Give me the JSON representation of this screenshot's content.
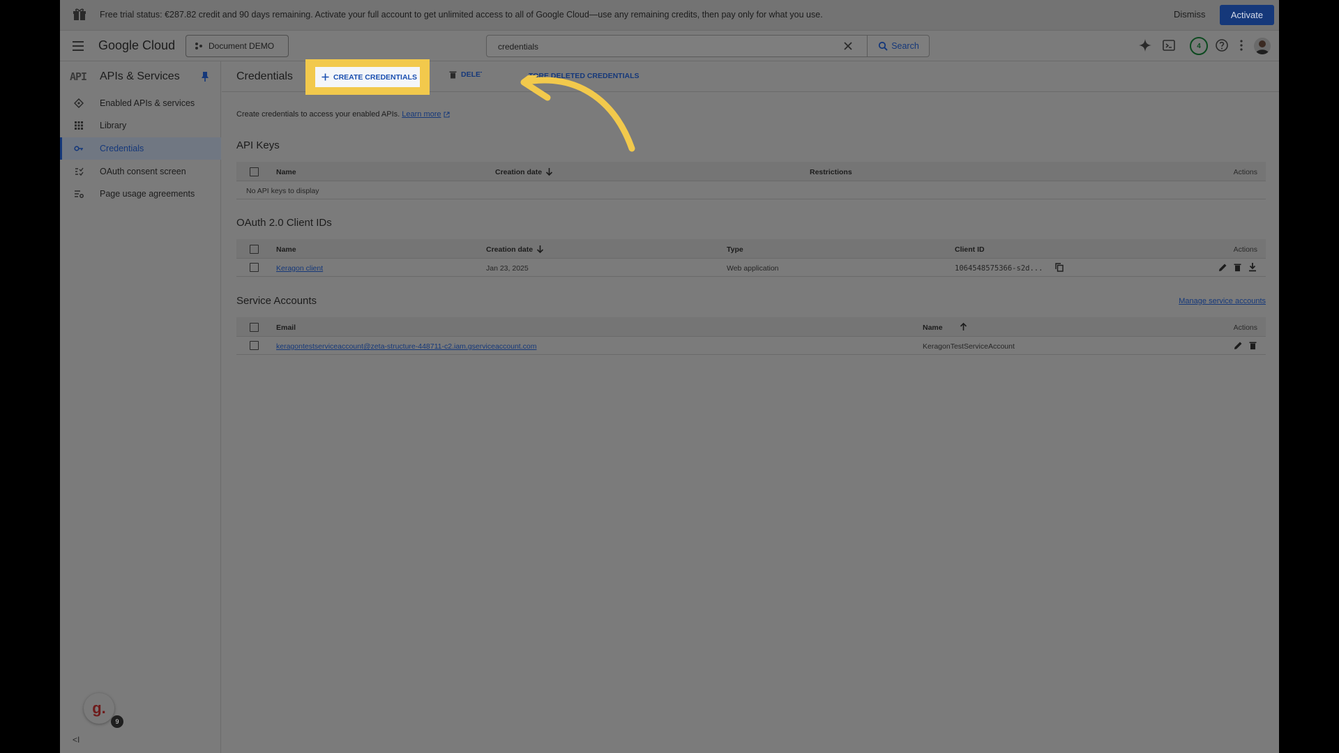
{
  "banner": {
    "text": "Free trial status: €287.82 credit and 90 days remaining. Activate your full account to get unlimited access to all of Google Cloud—use any remaining credits, then pay only for what you use.",
    "dismiss_label": "Dismiss",
    "activate_label": "Activate"
  },
  "header": {
    "logo_text": "Google Cloud",
    "project_label": "Document DEMO",
    "search_value": "credentials",
    "search_button_label": "Search",
    "notification_count": "4"
  },
  "sidebar": {
    "api_mark": "API",
    "title": "APIs & Services",
    "items": [
      {
        "label": "Enabled APIs & services",
        "icon": "diamond-icon"
      },
      {
        "label": "Library",
        "icon": "library-icon"
      },
      {
        "label": "Credentials",
        "icon": "key-icon",
        "active": true
      },
      {
        "label": "OAuth consent screen",
        "icon": "consent-icon"
      },
      {
        "label": "Page usage agreements",
        "icon": "settings-list-icon"
      }
    ],
    "assistant_letter": "g.",
    "assistant_count": "9",
    "collapse_label": "<I"
  },
  "main": {
    "page_title": "Credentials",
    "create_label": "CREATE CREDENTIALS",
    "delete_label": "DELETE",
    "restore_label": "TORE DELETED CREDENTIALS",
    "description": "Create credentials to access your enabled APIs.",
    "learn_more": "Learn more",
    "api_keys": {
      "title": "API Keys",
      "columns": [
        "Name",
        "Creation date",
        "Restrictions",
        "Actions"
      ],
      "empty": "No API keys to display"
    },
    "oauth": {
      "title": "OAuth 2.0 Client IDs",
      "columns": [
        "Name",
        "Creation date",
        "Type",
        "Client ID",
        "Actions"
      ],
      "rows": [
        {
          "name": "Keragon client",
          "date": "Jan 23, 2025",
          "type": "Web application",
          "client_id": "1064548575366-s2d..."
        }
      ]
    },
    "service_accounts": {
      "title": "Service Accounts",
      "manage_label": "Manage service accounts",
      "columns": [
        "Email",
        "Name",
        "Actions"
      ],
      "rows": [
        {
          "email": "keragontestserviceaccount@zeta-structure-448711-c2.iam.gserviceaccount.com",
          "name": "KeragonTestServiceAccount"
        }
      ]
    }
  },
  "colors": {
    "highlight": "#f2c94c",
    "link": "#15387a",
    "activate": "#15387a"
  }
}
